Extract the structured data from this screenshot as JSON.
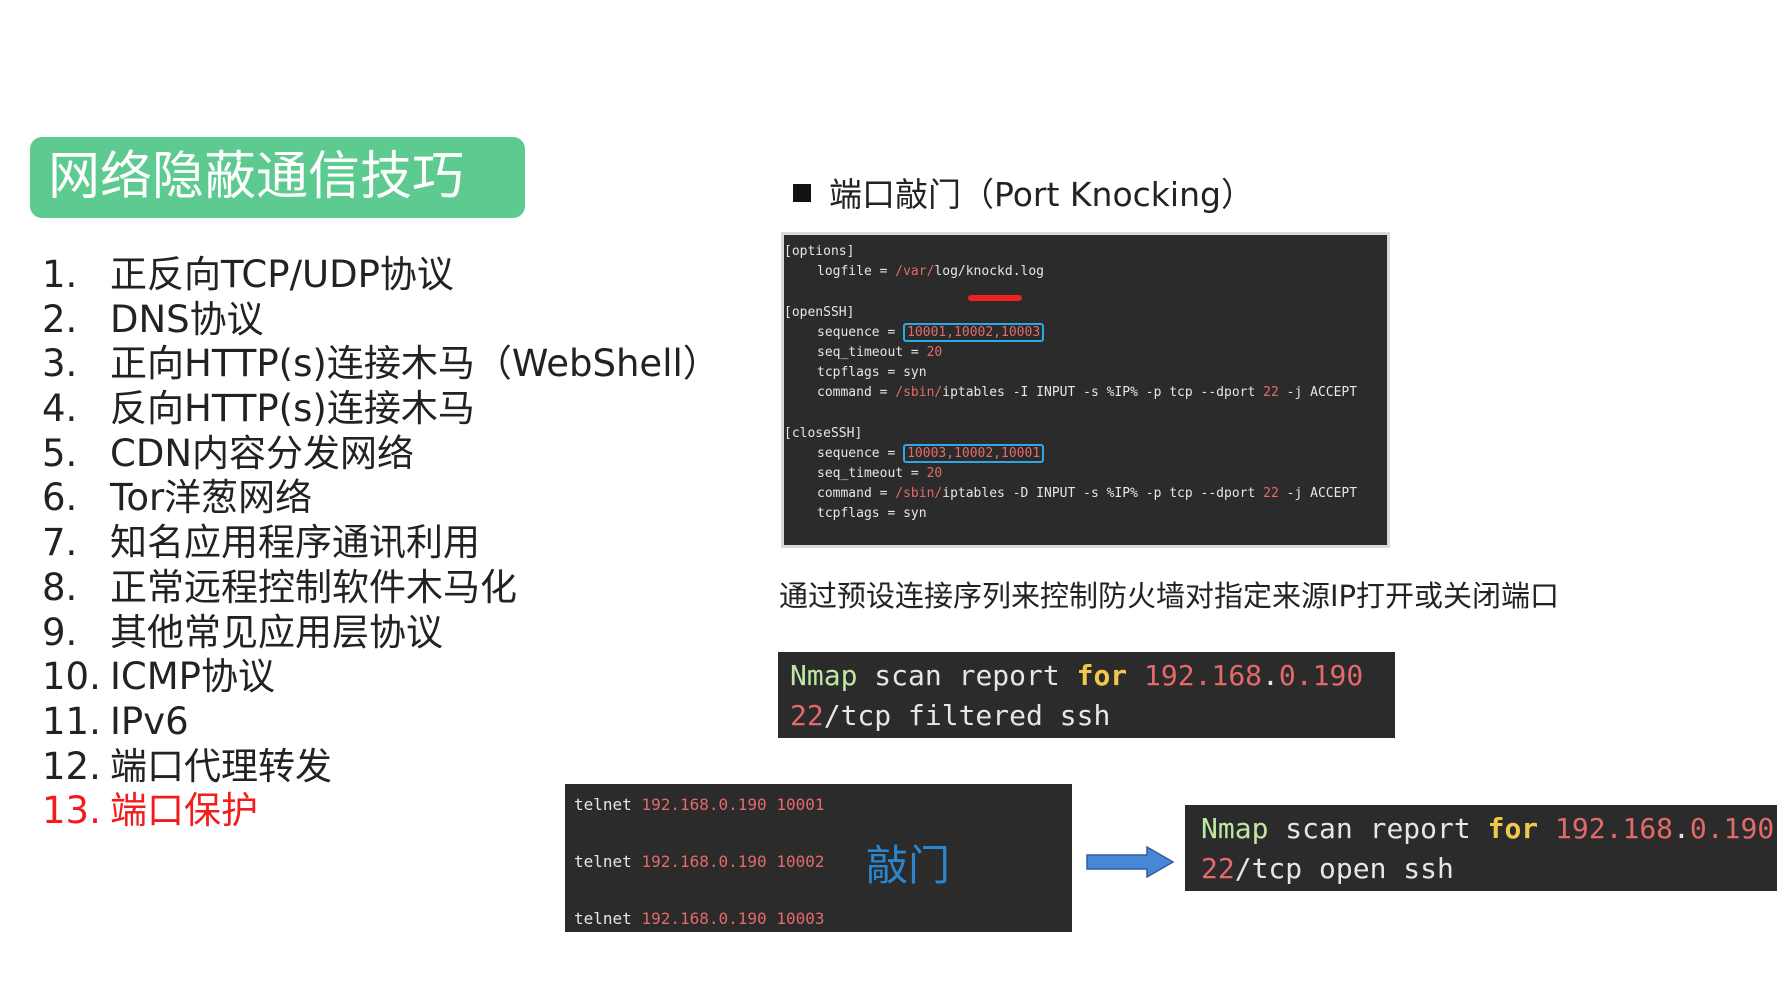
{
  "title": "网络隐蔽通信技巧",
  "outline": [
    {
      "num": "1.",
      "text": "正反向TCP/UDP协议"
    },
    {
      "num": "2.",
      "text": "DNS协议"
    },
    {
      "num": "3.",
      "text": "正向HTTP(s)连接木马（WebShell）"
    },
    {
      "num": "4.",
      "text": "反向HTTP(s)连接木马"
    },
    {
      "num": "5.",
      "text": "CDN内容分发网络"
    },
    {
      "num": "6.",
      "text": "Tor洋葱网络"
    },
    {
      "num": "7.",
      "text": "知名应用程序通讯利用"
    },
    {
      "num": "8.",
      "text": "正常远程控制软件木马化"
    },
    {
      "num": "9.",
      "text": "其他常见应用层协议"
    },
    {
      "num": "10.",
      "text": "ICMP协议"
    },
    {
      "num": "11.",
      "text": "IPv6"
    },
    {
      "num": "12.",
      "text": "端口代理转发"
    },
    {
      "num": "13.",
      "text": "端口保护",
      "active": true
    }
  ],
  "section": {
    "heading": "端口敲门（Port Knocking）"
  },
  "config": {
    "options_header": "[options]",
    "logfile_key": "logfile = ",
    "logfile_path_a": "/var/",
    "logfile_path_b": "log/knockd.log",
    "open_header": "[openSSH]",
    "open_seq_key": "sequence = ",
    "open_seq_val": "10001,10002,10003",
    "open_timeout_key": "seq_timeout = ",
    "open_timeout_val": "20",
    "open_flags": "tcpflags = syn",
    "open_cmd_key": "command = ",
    "open_cmd_path": "/sbin/",
    "open_cmd_a": "iptables -I INPUT -s %IP% -p tcp --dport ",
    "open_cmd_port": "22",
    "open_cmd_b": " -j ACCEPT",
    "close_header": "[closeSSH]",
    "close_seq_key": "sequence = ",
    "close_seq_val": "10003,10002,10001",
    "close_timeout_key": "seq_timeout = ",
    "close_timeout_val": "20",
    "close_cmd_key": "command = ",
    "close_cmd_path": "/sbin/",
    "close_cmd_a": "iptables -D INPUT -s %IP% -p tcp --dport ",
    "close_cmd_port": "22",
    "close_cmd_b": " -j ACCEPT",
    "close_flags": "tcpflags = syn"
  },
  "caption": "通过预设连接序列来控制防火墙对指定来源IP打开或关闭端口",
  "nmap_before": {
    "word_nmap": "Nmap",
    "mid": " scan report ",
    "word_for": "for",
    "ip_a": " 192.168",
    "ip_dot": ".",
    "ip_b": "0.190",
    "port": "22",
    "rest": "/tcp filtered ssh"
  },
  "telnet": [
    {
      "cmd": "telnet ",
      "ip": "192.168.0.190",
      "port": "10001"
    },
    {
      "cmd": "telnet ",
      "ip": "192.168.0.190",
      "port": "10002"
    },
    {
      "cmd": "telnet ",
      "ip": "192.168.0.190",
      "port": "10003"
    }
  ],
  "knock_label": "敲门",
  "nmap_after": {
    "word_nmap": "Nmap",
    "mid": " scan report ",
    "word_for": "for",
    "ip_a": " 192.168",
    "ip_dot": ".",
    "ip_b": "0.190",
    "port": "22",
    "rest": "/tcp open ssh"
  },
  "colors": {
    "title_bg": "#5dcb90",
    "active_item": "#f21c1c",
    "terminal_bg": "#2b2b2b",
    "highlight_box": "#2ba8e8",
    "arrow": "#4a86d6"
  }
}
